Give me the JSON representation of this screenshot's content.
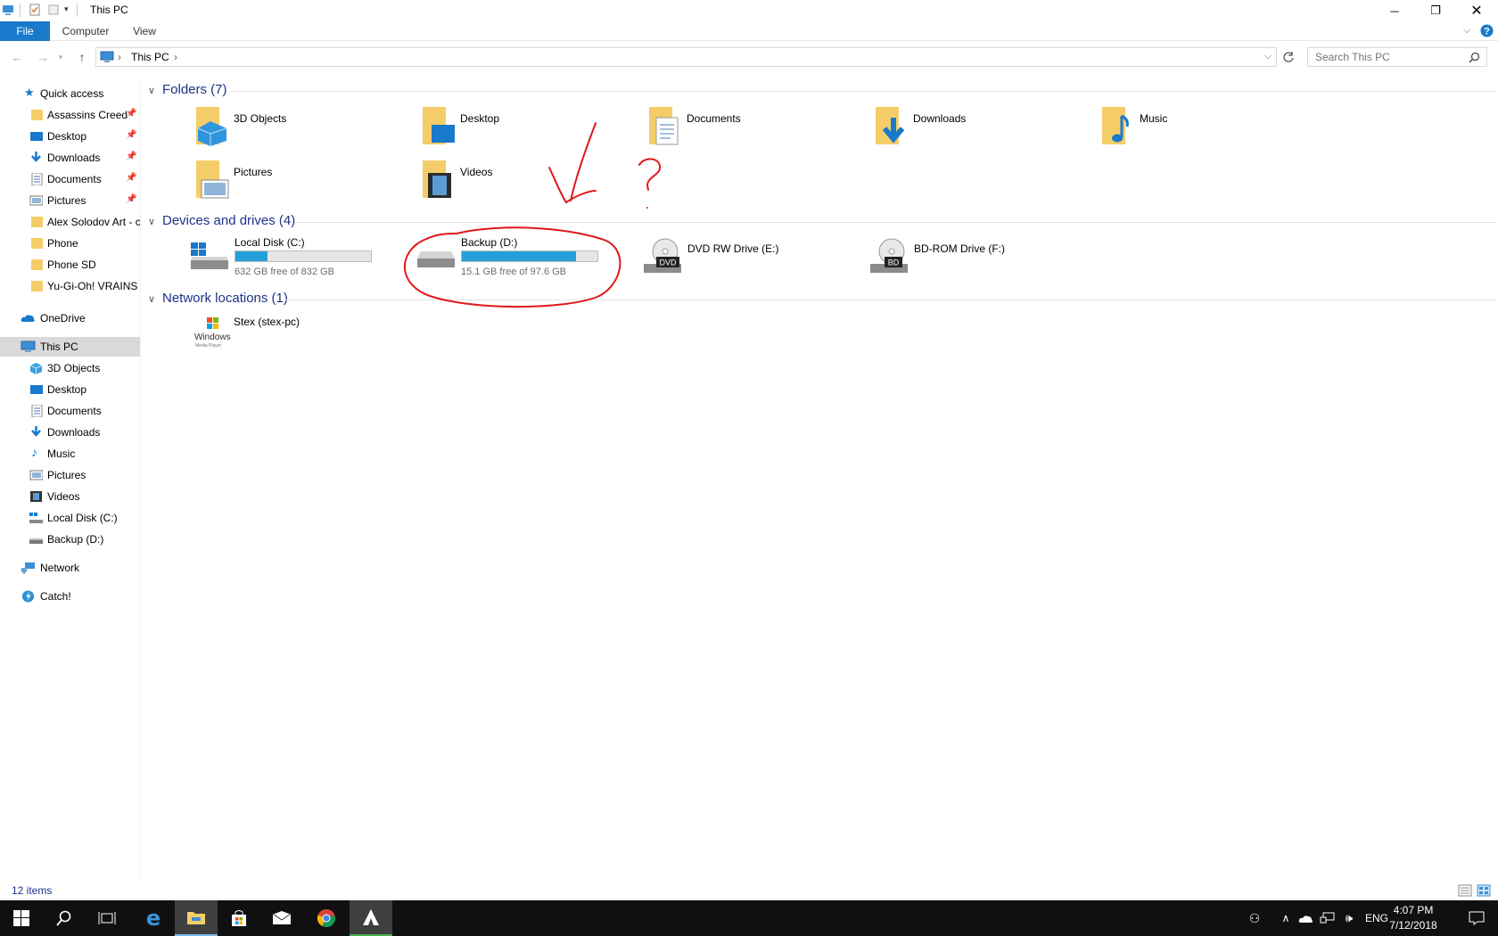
{
  "window": {
    "title": "This PC"
  },
  "ribbon": {
    "tabs": [
      "File",
      "Computer",
      "View"
    ]
  },
  "address": {
    "crumb": "This PC",
    "search_placeholder": "Search This PC"
  },
  "nav": {
    "quick_access": "Quick access",
    "quick_items": [
      "Assassins Creed",
      "Desktop",
      "Downloads",
      "Documents",
      "Pictures",
      "Alex Solodov Art - c",
      "Phone",
      "Phone SD",
      "Yu-Gi-Oh! VRAINS"
    ],
    "onedrive": "OneDrive",
    "this_pc": "This PC",
    "pc_items": [
      "3D Objects",
      "Desktop",
      "Documents",
      "Downloads",
      "Music",
      "Pictures",
      "Videos",
      "Local Disk (C:)",
      "Backup (D:)"
    ],
    "network": "Network",
    "catch": "Catch!"
  },
  "sections": {
    "folders": "Folders (7)",
    "devices": "Devices and drives (4)",
    "network": "Network locations (1)"
  },
  "folders": [
    "3D Objects",
    "Desktop",
    "Documents",
    "Downloads",
    "Music",
    "Pictures",
    "Videos"
  ],
  "drives": [
    {
      "name": "Local Disk (C:)",
      "free": "632 GB free of 832 GB",
      "used_fraction": 0.24
    },
    {
      "name": "Backup (D:)",
      "free": "15.1 GB free of 97.6 GB",
      "used_fraction": 0.845
    },
    {
      "name": "DVD RW Drive (E:)",
      "badge": "DVD"
    },
    {
      "name": "BD-ROM Drive (F:)",
      "badge": "BD"
    }
  ],
  "network_locations": [
    {
      "name": "Stex (stex-pc)",
      "icon_text": "Windows",
      "icon_subtext": "Media Player"
    }
  ],
  "status": {
    "items": "12 items"
  },
  "taskbar": {
    "lang": "ENG",
    "time": "4:07 PM",
    "date": "7/12/2018"
  },
  "colors": {
    "accent": "#1979ca",
    "section_header": "#1e3287",
    "bar_fill": "#26a0da",
    "annotation": "#e0181b",
    "folder": "#f5cd68"
  }
}
